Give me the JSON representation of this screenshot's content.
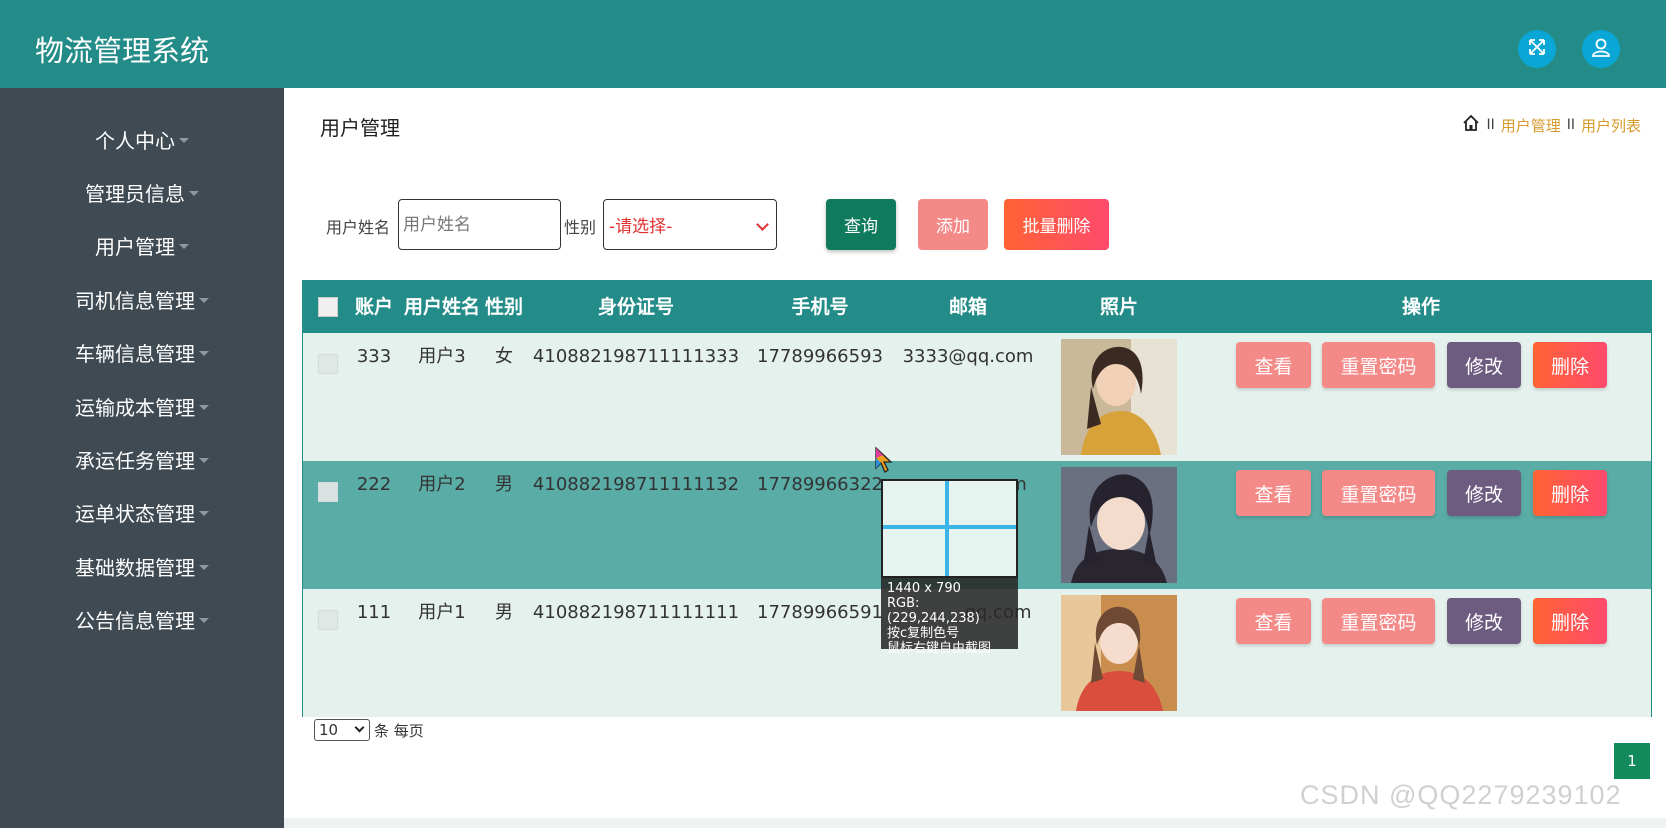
{
  "header": {
    "title": "物流管理系统",
    "accent_color": "#238c88",
    "icons": [
      "expand-icon",
      "user-icon"
    ]
  },
  "sidebar": {
    "items": [
      {
        "label": "个人中心"
      },
      {
        "label": "管理员信息"
      },
      {
        "label": "用户管理"
      },
      {
        "label": "司机信息管理"
      },
      {
        "label": "车辆信息管理"
      },
      {
        "label": "运输成本管理"
      },
      {
        "label": "承运任务管理"
      },
      {
        "label": "运单状态管理"
      },
      {
        "label": "基础数据管理"
      },
      {
        "label": "公告信息管理"
      }
    ]
  },
  "main": {
    "page_title": "用户管理",
    "breadcrumb": [
      "用户管理",
      "用户列表"
    ],
    "breadcrumb_sep": "II"
  },
  "search": {
    "name_label": "用户姓名",
    "name_placeholder": "用户姓名",
    "gender_label": "性别",
    "gender_selected": "-请选择-",
    "query_button": "查询",
    "add_button": "添加",
    "batch_delete_button": "批量删除"
  },
  "table": {
    "columns": [
      "账户",
      "用户姓名",
      "性别",
      "身份证号",
      "手机号",
      "邮箱",
      "照片",
      "操作"
    ],
    "rows": [
      {
        "account": "333",
        "name": "用户3",
        "gender": "女",
        "id_number": "410882198711111333",
        "phone": "17789966593",
        "email": "3333@qq.com"
      },
      {
        "account": "222",
        "name": "用户2",
        "gender": "男",
        "id_number": "410882198711111132",
        "phone": "17789966322",
        "email": "m"
      },
      {
        "account": "111",
        "name": "用户1",
        "gender": "男",
        "id_number": "410882198711111111",
        "phone": "17789966591",
        "email": "qq.com"
      }
    ],
    "actions": {
      "view": "查看",
      "reset": "重置密码",
      "edit": "修改",
      "delete": "删除"
    }
  },
  "pagination": {
    "page_size": "10",
    "per_page_text": "条 每页",
    "current_page": "1"
  },
  "picker": {
    "size": "1440 x 790",
    "rgb": "RGB:(229,244,238)",
    "hint1": "按c复制色号",
    "hint2": "鼠标右键自由截图"
  },
  "watermark": "CSDN @QQ2279239102"
}
